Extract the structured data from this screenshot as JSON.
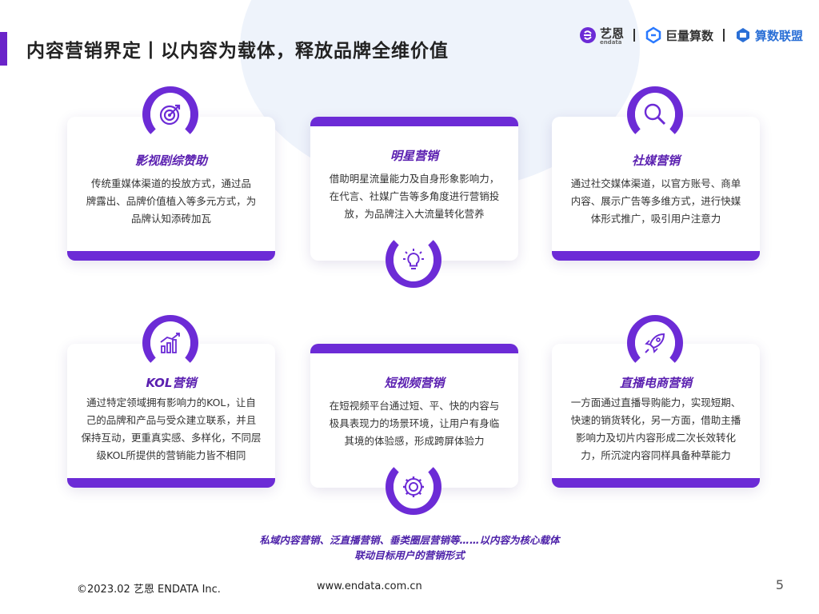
{
  "header": {
    "title": "内容营销界定丨以内容为载体，释放品牌全维价值",
    "logos": [
      {
        "name": "艺恩",
        "sub": "endata"
      },
      {
        "name": "巨量算数"
      },
      {
        "name": "算数联盟"
      }
    ]
  },
  "cards": [
    {
      "title": "影视剧综赞助",
      "lines": [
        "传统重媒体渠道的投放方式，通过品",
        "牌露出、品牌价值植入等多元方式，为",
        "品牌认知添砖加瓦"
      ],
      "icon": "target-icon"
    },
    {
      "title": "明星营销",
      "lines": [
        "借助明星流量能力及自身形象影响力，",
        "在代言、社媒广告等多角度进行营销投",
        "放，为品牌注入大流量转化营养"
      ],
      "icon": "lightbulb-icon"
    },
    {
      "title": "社媒营销",
      "lines": [
        "通过社交媒体渠道，以官方账号、商单",
        "内容、展示广告等多维方式，进行快媒",
        "体形式推广，吸引用户注意力"
      ],
      "icon": "magnifier-icon"
    },
    {
      "title": "KOL营销",
      "lines": [
        "通过特定领域拥有影响力的KOL，让自",
        "己的品牌和产品与受众建立联系，并且",
        "保持互动，更重真实感、多样化，不同层",
        "级KOL所提供的营销能力皆不相同"
      ],
      "icon": "bar-chart-icon"
    },
    {
      "title": "短视频营销",
      "lines": [
        "在短视频平台通过短、平、快的内容与",
        "极具表现力的场景环境，让用户有身临",
        "其境的体验感，形成跨屏体验力"
      ],
      "icon": "gear-icon"
    },
    {
      "title": "直播电商营销",
      "lines": [
        "一方面通过直播导购能力，实现短期、",
        "快速的销货转化，另一方面，借助主播",
        "影响力及切片内容形成二次长效转化",
        "力，所沉淀内容同样具备种草能力"
      ],
      "icon": "rocket-icon"
    }
  ],
  "note": {
    "line1": "私域内容营销、泛直播营销、垂类圈层营销等……以内容为核心载体",
    "line2": "联动目标用户的营销形式"
  },
  "footer": {
    "copyright": "©2023.02 艺恩 ENDATA Inc.",
    "url": "www.endata.com.cn",
    "page": "5"
  },
  "colors": {
    "accent": "#6c2bd6",
    "title": "#5a1fb0"
  }
}
